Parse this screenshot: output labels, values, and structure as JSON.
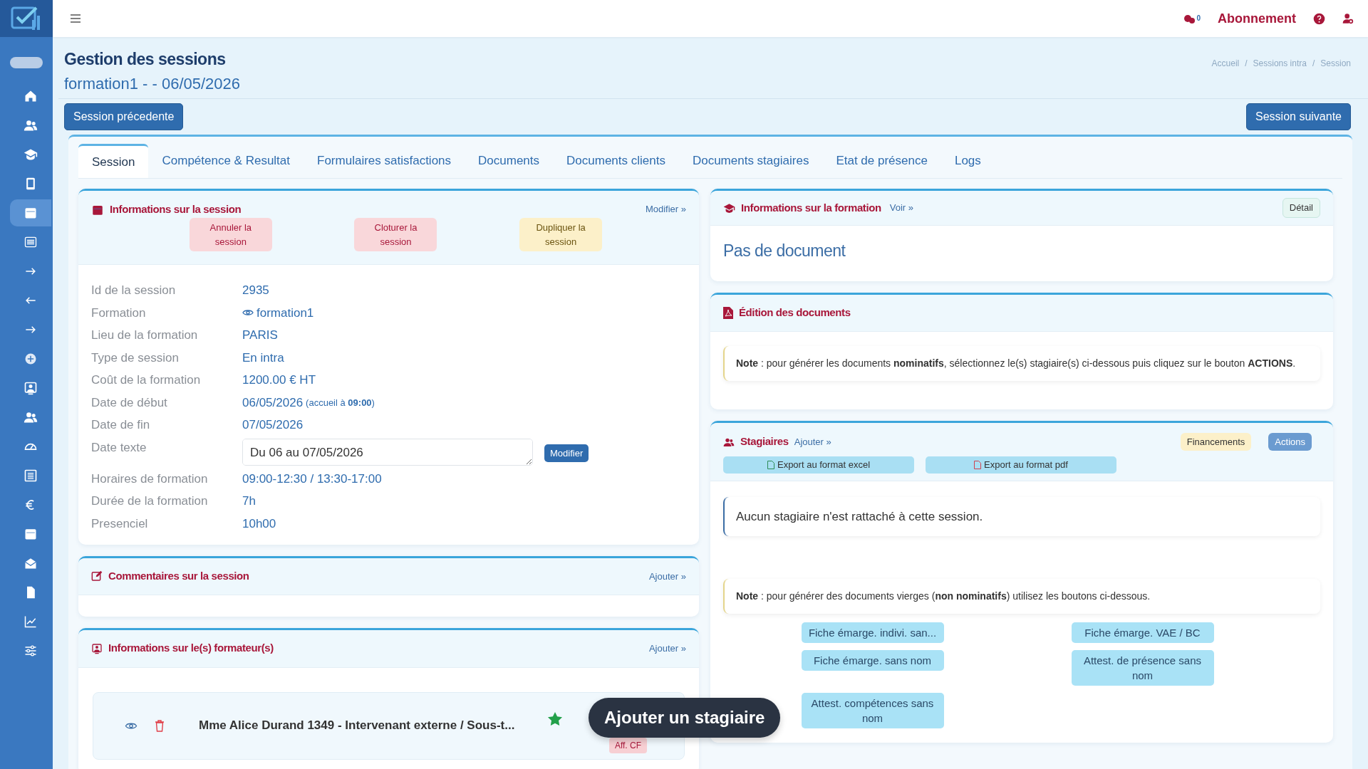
{
  "topbar": {
    "notification_count": "0",
    "subscription": "Abonnement"
  },
  "sidebar": {
    "items": [
      {
        "kind": "home",
        "selected": false
      },
      {
        "kind": "users",
        "selected": false
      },
      {
        "kind": "cap",
        "selected": false
      },
      {
        "kind": "tablet",
        "selected": false
      },
      {
        "kind": "calendar",
        "selected": true
      },
      {
        "kind": "list",
        "selected": false
      },
      {
        "kind": "arrow-right",
        "selected": false
      },
      {
        "kind": "arrow-left",
        "selected": false
      },
      {
        "kind": "arrow-right",
        "selected": false
      },
      {
        "kind": "plus",
        "selected": false
      },
      {
        "kind": "user-square",
        "selected": false
      },
      {
        "kind": "users",
        "selected": false
      },
      {
        "kind": "gauge",
        "selected": false
      },
      {
        "kind": "newspaper",
        "selected": false
      },
      {
        "kind": "euro",
        "selected": false
      },
      {
        "kind": "calendar",
        "selected": false
      },
      {
        "kind": "mail",
        "selected": false
      },
      {
        "kind": "file",
        "selected": false
      },
      {
        "kind": "chart",
        "selected": false
      },
      {
        "kind": "sliders",
        "selected": false
      }
    ]
  },
  "header": {
    "title": "Gestion des sessions",
    "subtitle": "formation1 - - 06/05/2026",
    "breadcrumb": [
      "Accueil",
      "Sessions intra",
      "Session"
    ],
    "breadcrumb_separator": "/"
  },
  "nav_buttons": {
    "previous": "Session précedente",
    "next": "Session suivante"
  },
  "tabs": [
    {
      "label": "Session",
      "selected": true
    },
    {
      "label": "Compétence & Resultat",
      "selected": false
    },
    {
      "label": "Formulaires satisfactions",
      "selected": false
    },
    {
      "label": "Documents",
      "selected": false
    },
    {
      "label": "Documents clients",
      "selected": false
    },
    {
      "label": "Documents stagiaires",
      "selected": false
    },
    {
      "label": "Etat de présence",
      "selected": false
    },
    {
      "label": "Logs",
      "selected": false
    }
  ],
  "session_info": {
    "title": "Informations sur la session",
    "edit_link": "Modifier »",
    "actions": [
      {
        "label": "Annuler la session",
        "kind": "danger"
      },
      {
        "label": "Cloturer la session",
        "kind": "danger"
      },
      {
        "label": "Dupliquer la session",
        "kind": "warning"
      }
    ],
    "fields": [
      {
        "label": "Id de la session",
        "value": "2935",
        "kind": "text"
      },
      {
        "label": "Formation",
        "value": "formation1",
        "kind": "link"
      },
      {
        "label": "Lieu de la formation",
        "value": "PARIS",
        "kind": "text"
      },
      {
        "label": "Type de session",
        "value": "En intra",
        "kind": "text"
      },
      {
        "label": "Coût de la formation",
        "value": "1200.00 € HT",
        "kind": "text"
      },
      {
        "label": "Date de début",
        "value": "06/05/2026",
        "note": "(accueil à **09:00**)",
        "kind": "text"
      },
      {
        "label": "Date de fin",
        "value": "07/05/2026",
        "kind": "text"
      },
      {
        "label": "Date texte",
        "value": "Du 06 au 07/05/2026",
        "button": "Modifier",
        "kind": "input"
      },
      {
        "label": "Horaires de formation",
        "value": "09:00-12:30 / 13:30-17:00",
        "kind": "text"
      },
      {
        "label": "Durée de la formation",
        "value": "7h",
        "kind": "text"
      },
      {
        "label": "Presenciel",
        "value": "10h00",
        "kind": "text"
      }
    ]
  },
  "comments": {
    "title": "Commentaires sur la session",
    "add_link": "Ajouter »"
  },
  "trainers": {
    "title": "Informations sur le(s) formateur(s)",
    "add_link": "Ajouter »",
    "items": [
      {
        "name": "Mme Alice Durand 1349 - Intervenant externe / Sous-t...",
        "starred": true,
        "badge": "Aff. CF"
      }
    ]
  },
  "formation_info": {
    "title": "Informations sur la formation",
    "link": "Voir »",
    "detail_button": "Détail",
    "empty_text": "Pas de document"
  },
  "documents": {
    "title": "Édition des documents",
    "note": "**Note** : pour générer les documents **nominatifs**, sélectionnez le(s) stagiaire(s) ci-dessous puis cliquez sur le bouton **ACTIONS**."
  },
  "trainees": {
    "title": "Stagiaires",
    "add_link": "Ajouter »",
    "buttons": [
      {
        "label": "Financements",
        "kind": "warning"
      },
      {
        "label": "Actions",
        "kind": "primary"
      }
    ],
    "exports": [
      {
        "label": "Export au format excel",
        "kind": "excel"
      },
      {
        "label": "Export au format pdf",
        "kind": "pdf"
      }
    ],
    "empty_text": "Aucun stagiaire n'est rattaché à cette session.",
    "note": "**Note** : pour générer des documents vierges (**non nominatifs**) utilisez les boutons ci-dessous.",
    "blank_documents": [
      "Fiche émarge. indivi. san...",
      "Fiche émarge. VAE / BC",
      "Fiche émarge. sans nom",
      "Attest. de présence sans nom",
      "Attest. compétences sans nom"
    ]
  },
  "toast": {
    "text": "Ajouter un stagiaire"
  }
}
